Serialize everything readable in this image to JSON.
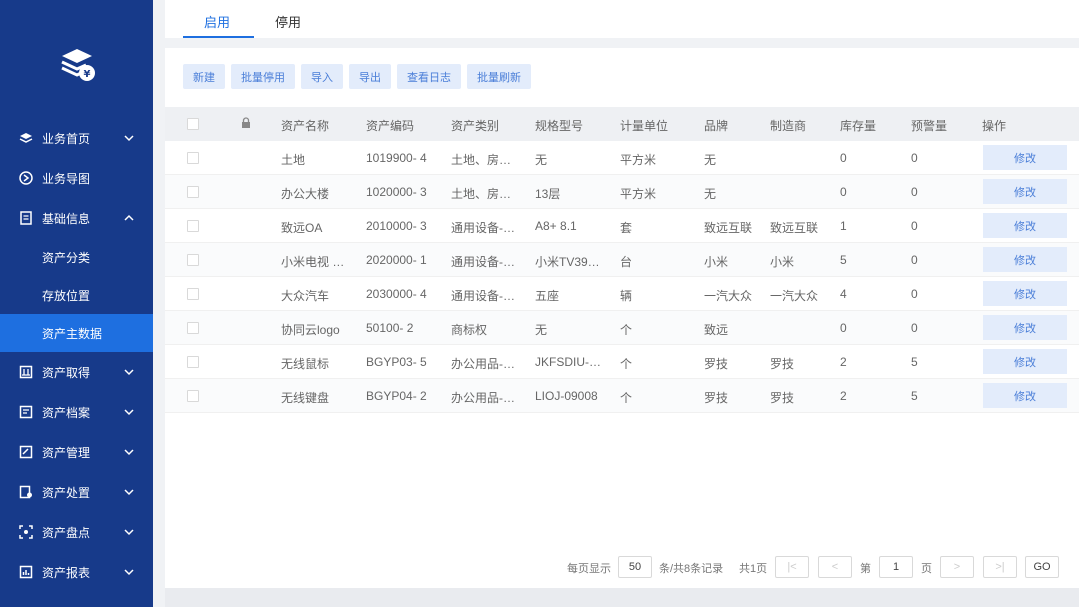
{
  "sidebar": {
    "menu": [
      {
        "label": "业务首页",
        "icon": "layers-icon",
        "chevron": "down"
      },
      {
        "label": "业务导图",
        "icon": "route-icon",
        "chevron": ""
      },
      {
        "label": "基础信息",
        "icon": "document-icon",
        "chevron": "up"
      }
    ],
    "sub": [
      "资产分类",
      "存放位置",
      "资产主数据"
    ],
    "menu2": [
      {
        "label": "资产取得",
        "icon": "inbox-icon"
      },
      {
        "label": "资产档案",
        "icon": "archive-icon"
      },
      {
        "label": "资产管理",
        "icon": "edit-icon"
      },
      {
        "label": "资产处置",
        "icon": "dispose-icon"
      },
      {
        "label": "资产盘点",
        "icon": "scan-icon"
      },
      {
        "label": "资产报表",
        "icon": "report-icon"
      }
    ]
  },
  "tabs": {
    "enabled": "启用",
    "disabled": "停用"
  },
  "toolbar": {
    "new": "新建",
    "batch_disable": "批量停用",
    "import": "导入",
    "export": "导出",
    "view_log": "查看日志",
    "batch_refresh": "批量刷新"
  },
  "table": {
    "headers": [
      "资产名称",
      "资产编码",
      "资产类别",
      "规格型号",
      "计量单位",
      "品牌",
      "制造商",
      "库存量",
      "预警量",
      "操作"
    ],
    "edit_label": "修改",
    "rows": [
      [
        "土地",
        "1019900- 4",
        "土地、房…",
        "无",
        "平方米",
        "无",
        "",
        "0",
        "0"
      ],
      [
        "办公大楼",
        "1020000- 3",
        "土地、房…",
        "13层",
        "平方米",
        "无",
        "",
        "0",
        "0"
      ],
      [
        "致远OA",
        "2010000- 3",
        "通用设备-…",
        "A8+ 8.1",
        "套",
        "致远互联",
        "致远互联",
        "1",
        "0"
      ],
      [
        "小米电视 …",
        "2020000- 1",
        "通用设备-…",
        "小米TV39…",
        "台",
        "小米",
        "小米",
        "5",
        "0"
      ],
      [
        "大众汽车",
        "2030000- 4",
        "通用设备-…",
        "五座",
        "辆",
        "一汽大众",
        "一汽大众",
        "4",
        "0"
      ],
      [
        "协同云logo",
        "50100- 2",
        "商标权",
        "无",
        "个",
        "致远",
        "",
        "0",
        "0"
      ],
      [
        "无线鼠标",
        "BGYP03- 5",
        "办公用品-…",
        "JKFSDIU-…",
        "个",
        "罗技",
        "罗技",
        "2",
        "5"
      ],
      [
        "无线键盘",
        "BGYP04- 2",
        "办公用品-…",
        "LIOJ-09008",
        "个",
        "罗技",
        "罗技",
        "2",
        "5"
      ]
    ]
  },
  "pager": {
    "per_page_label": "每页显示",
    "per_page": "50",
    "summary": "条/共8条记录",
    "total_pages": "共1页",
    "page_prefix": "第",
    "page": "1",
    "page_suffix": "页",
    "go": "GO",
    "first": "|<",
    "prev": "<",
    "next": ">",
    "last": ">|"
  },
  "colors": {
    "sidebar": "#173a8a",
    "active": "#1e6fe0",
    "button_bg": "#e3ecfb",
    "button_text": "#4a7ed8"
  }
}
